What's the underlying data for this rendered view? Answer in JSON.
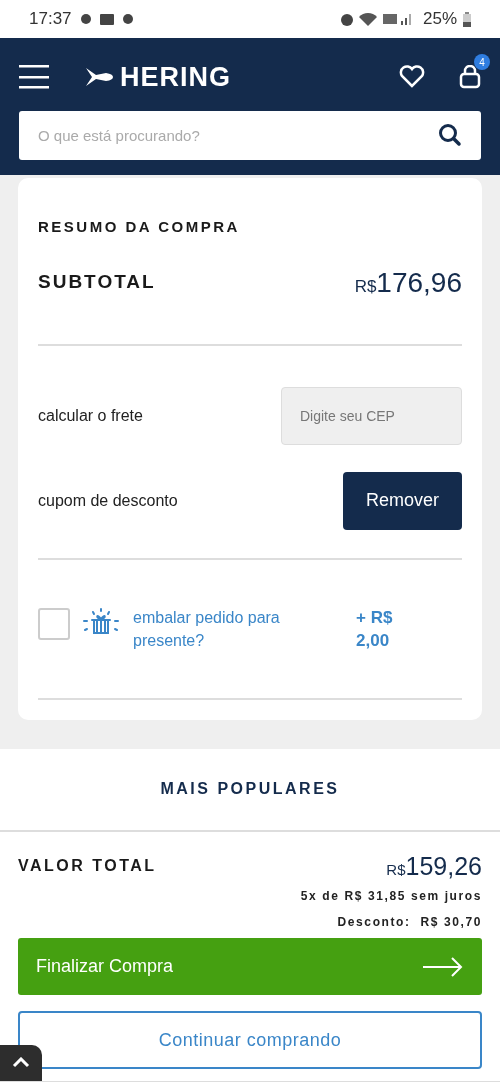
{
  "status_bar": {
    "time": "17:37",
    "battery": "25%"
  },
  "header": {
    "logo": "HERING",
    "cart_count": "4",
    "search": {
      "placeholder": "O que está procurando?"
    }
  },
  "summary": {
    "title": "RESUMO DA COMPRA",
    "subtotal_label": "SUBTOTAL",
    "subtotal_currency": "R$",
    "subtotal_value": "176,96",
    "shipping": {
      "label": "calcular o frete",
      "placeholder": "Digite seu CEP"
    },
    "coupon": {
      "label": "cupom de desconto",
      "button": "Remover"
    },
    "gift": {
      "checked": false,
      "label": "embalar pedido para presente?",
      "price": "+ R$ 2,00"
    }
  },
  "popular": {
    "title": "MAIS POPULARES"
  },
  "total": {
    "label": "VALOR TOTAL",
    "currency": "R$",
    "value": "159,26",
    "installments": "5x de R$ 31,85 sem juros",
    "discount": "Desconto:  R$ 30,70",
    "checkout_button": "Finalizar Compra",
    "continue_button": "Continuar comprando"
  }
}
